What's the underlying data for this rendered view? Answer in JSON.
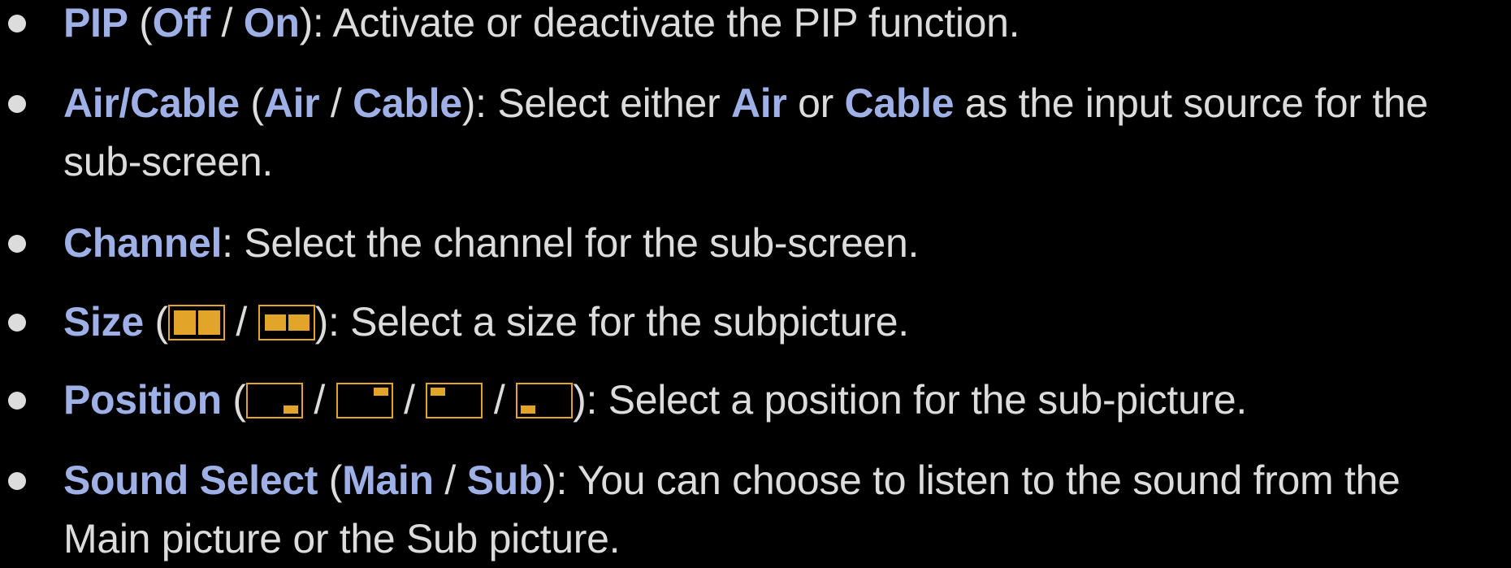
{
  "colors": {
    "background": "#000000",
    "body_text": "#dcdcdc",
    "keyword": "#9fb0e6",
    "icon_accent": "#e2a52a"
  },
  "items": [
    {
      "term": "PIP",
      "open": " (",
      "opt1": "Off",
      "sep1": " / ",
      "opt2": "On",
      "desc": "): Activate or deactivate the PIP function."
    },
    {
      "term": "Air/Cable",
      "open": " (",
      "opt1": "Air",
      "sep1": " / ",
      "opt2": "Cable",
      "desc1": "): Select either ",
      "kw1": "Air",
      "mid": " or ",
      "kw2": "Cable",
      "desc2": " as the input source for the",
      "line2": "sub-screen."
    },
    {
      "term": "Channel",
      "desc": ": Select the channel for the sub-screen."
    },
    {
      "term": "Size",
      "open": " (",
      "sep": " / ",
      "desc": "): Select a size for the subpicture.",
      "icons": [
        "size-large-icon",
        "size-small-icon"
      ]
    },
    {
      "term": "Position",
      "open": " (",
      "sep": " / ",
      "desc": "): Select a position for the sub-picture.",
      "icons": [
        "position-bottom-right-icon",
        "position-top-right-icon",
        "position-top-left-icon",
        "position-bottom-left-icon"
      ]
    },
    {
      "term": "Sound Select",
      "open": " (",
      "opt1": "Main",
      "sep1": " / ",
      "opt2": "Sub",
      "desc": "): You can choose to listen to the sound from the",
      "line2": "Main picture or the Sub picture."
    }
  ]
}
